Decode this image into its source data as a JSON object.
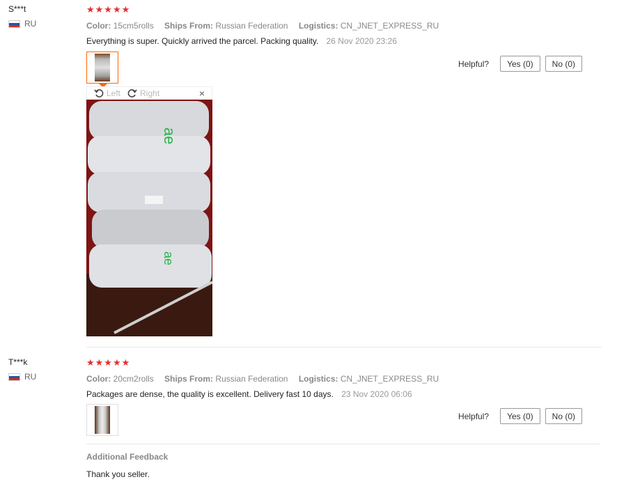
{
  "colors": {
    "star": "#e62e2e",
    "accent": "#ff6600"
  },
  "reviews": [
    {
      "user": "S***t",
      "country": "RU",
      "stars": "★★★★★",
      "color_label": "Color:",
      "color_value": "15cm5rolls",
      "ships_label": "Ships From:",
      "ships_value": "Russian Federation",
      "logistics_label": "Logistics:",
      "logistics_value": "CN_JNET_EXPRESS_RU",
      "text": "Everything is super. Quickly arrived the parcel. Packing quality.",
      "date": "26 Nov 2020 23:26",
      "helpful_label": "Helpful?",
      "yes_label": "Yes (0)",
      "no_label": "No (0)",
      "viewer": {
        "rotate_left_label": "Left",
        "rotate_right_label": "Right",
        "close_icon": "×"
      }
    },
    {
      "user": "T***k",
      "country": "RU",
      "stars": "★★★★★",
      "color_label": "Color:",
      "color_value": "20cm2rolls",
      "ships_label": "Ships From:",
      "ships_value": "Russian Federation",
      "logistics_label": "Logistics:",
      "logistics_value": "CN_JNET_EXPRESS_RU",
      "text": "Packages are dense, the quality is excellent. Delivery fast 10 days.",
      "date": "23 Nov 2020 06:06",
      "helpful_label": "Helpful?",
      "yes_label": "Yes (0)",
      "no_label": "No (0)",
      "additional_title": "Additional Feedback",
      "additional_text": "Thank you seller."
    }
  ]
}
